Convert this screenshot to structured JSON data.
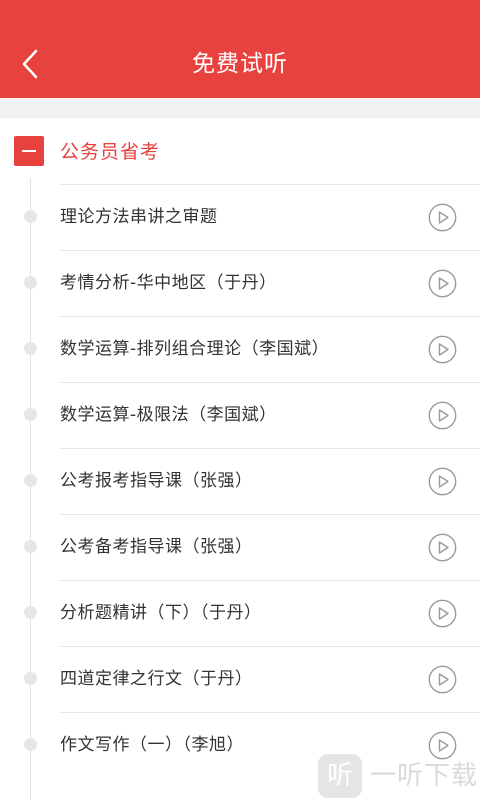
{
  "header": {
    "title": "免费试听",
    "back_icon": "chevron-left-icon",
    "color": "#e8423e"
  },
  "section": {
    "title": "公务员省考",
    "expanded": true,
    "toggle_icon": "minus-square-icon"
  },
  "lessons": [
    {
      "title": "理论方法串讲之审题"
    },
    {
      "title": "考情分析-华中地区（于丹）"
    },
    {
      "title": "数学运算-排列组合理论（李国斌）"
    },
    {
      "title": "数学运算-极限法（李国斌）"
    },
    {
      "title": "公考报考指导课（张强）"
    },
    {
      "title": "公考备考指导课（张强）"
    },
    {
      "title": "分析题精讲（下）（于丹）"
    },
    {
      "title": "四道定律之行文（于丹）"
    },
    {
      "title": "作文写作（一）（李旭）"
    }
  ],
  "watermark": {
    "logo": "听",
    "text": "一听下载"
  }
}
